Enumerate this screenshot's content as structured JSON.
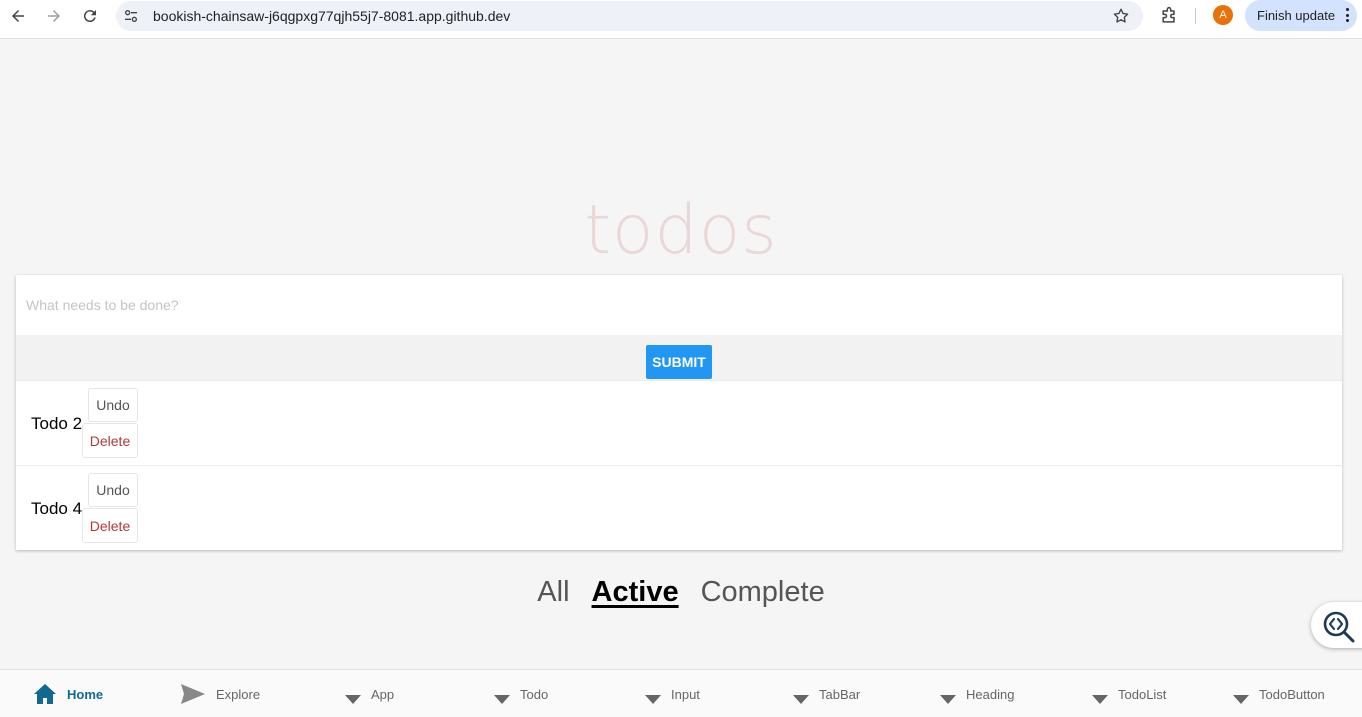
{
  "browser": {
    "url": "bookish-chainsaw-j6qgpxg77qjh55j7-8081.app.github.dev",
    "avatar_letter": "A",
    "finish_update_label": "Finish update"
  },
  "app": {
    "heading": "todos",
    "input_placeholder": "What needs to be done?",
    "submit_label": "SUBMIT",
    "todos": [
      {
        "title": "Todo 2",
        "undo_label": "Undo",
        "delete_label": "Delete"
      },
      {
        "title": "Todo 4",
        "undo_label": "Undo",
        "delete_label": "Delete"
      }
    ],
    "filters": [
      {
        "label": "All",
        "active": false
      },
      {
        "label": "Active",
        "active": true
      },
      {
        "label": "Complete",
        "active": false
      }
    ]
  },
  "bottom_nav": {
    "items": [
      {
        "label": "Home",
        "icon": "home-icon",
        "selected": true
      },
      {
        "label": "Explore",
        "icon": "send-icon",
        "selected": false
      },
      {
        "label": "App",
        "icon": "triangle-down-icon",
        "selected": false
      },
      {
        "label": "Todo",
        "icon": "triangle-down-icon",
        "selected": false
      },
      {
        "label": "Input",
        "icon": "triangle-down-icon",
        "selected": false
      },
      {
        "label": "TabBar",
        "icon": "triangle-down-icon",
        "selected": false
      },
      {
        "label": "Heading",
        "icon": "triangle-down-icon",
        "selected": false
      },
      {
        "label": "TodoList",
        "icon": "triangle-down-icon",
        "selected": false
      },
      {
        "label": "TodoButton",
        "icon": "triangle-down-icon",
        "selected": false
      }
    ]
  },
  "colors": {
    "heading": "#ead7d7",
    "submit": "#2196f3",
    "delete_text": "#b03a3a",
    "nav_selected": "#12698f",
    "finish_update_bg": "#d3e3fd",
    "avatar_bg": "#e8710a"
  }
}
